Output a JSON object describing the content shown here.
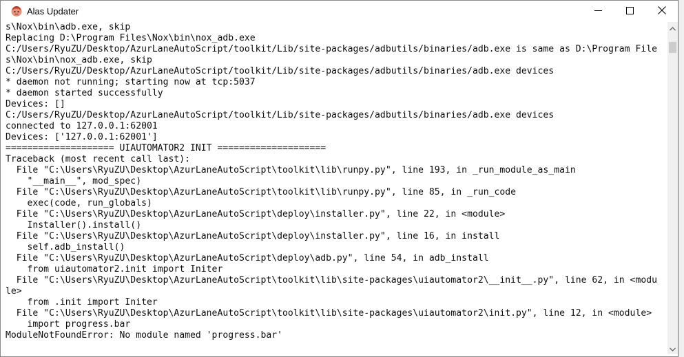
{
  "window": {
    "title": "Alas Updater",
    "icon": "alas-app-icon",
    "controls": {
      "minimize": "minimize-icon",
      "maximize": "maximize-icon",
      "close": "close-icon"
    }
  },
  "console": {
    "lines": [
      "s\\Nox\\bin\\adb.exe, skip",
      "Replacing D:\\Program Files\\Nox\\bin\\nox_adb.exe",
      "C:/Users/RyuZU/Desktop/AzurLaneAutoScript/toolkit/Lib/site-packages/adbutils/binaries/adb.exe is same as D:\\Program File",
      "s\\Nox\\bin\\nox_adb.exe, skip",
      "C:/Users/RyuZU/Desktop/AzurLaneAutoScript/toolkit/Lib/site-packages/adbutils/binaries/adb.exe devices",
      "* daemon not running; starting now at tcp:5037",
      "* daemon started successfully",
      "Devices: []",
      "C:/Users/RyuZU/Desktop/AzurLaneAutoScript/toolkit/Lib/site-packages/adbutils/binaries/adb.exe devices",
      "connected to 127.0.0.1:62001",
      "Devices: ['127.0.0.1:62001']",
      "==================== UIAUTOMATOR2 INIT ====================",
      "Traceback (most recent call last):",
      "  File \"C:\\Users\\RyuZU\\Desktop\\AzurLaneAutoScript\\toolkit\\lib\\runpy.py\", line 193, in _run_module_as_main",
      "    \"__main__\", mod_spec)",
      "  File \"C:\\Users\\RyuZU\\Desktop\\AzurLaneAutoScript\\toolkit\\lib\\runpy.py\", line 85, in _run_code",
      "    exec(code, run_globals)",
      "  File \"C:\\Users\\RyuZU\\Desktop\\AzurLaneAutoScript\\deploy\\installer.py\", line 22, in <module>",
      "    Installer().install()",
      "  File \"C:\\Users\\RyuZU\\Desktop\\AzurLaneAutoScript\\deploy\\installer.py\", line 16, in install",
      "    self.adb_install()",
      "  File \"C:\\Users\\RyuZU\\Desktop\\AzurLaneAutoScript\\deploy\\adb.py\", line 54, in adb_install",
      "    from uiautomator2.init import Initer",
      "  File \"C:\\Users\\RyuZU\\Desktop\\AzurLaneAutoScript\\toolkit\\lib\\site-packages\\uiautomator2\\__init__.py\", line 62, in <modu",
      "le>",
      "    from .init import Initer",
      "  File \"C:\\Users\\RyuZU\\Desktop\\AzurLaneAutoScript\\toolkit\\lib\\site-packages\\uiautomator2\\init.py\", line 12, in <module>",
      "    import progress.bar",
      "ModuleNotFoundError: No module named 'progress.bar'"
    ]
  },
  "scrollbar": {
    "up": "scroll-up-arrow-icon",
    "down": "scroll-down-arrow-icon"
  }
}
